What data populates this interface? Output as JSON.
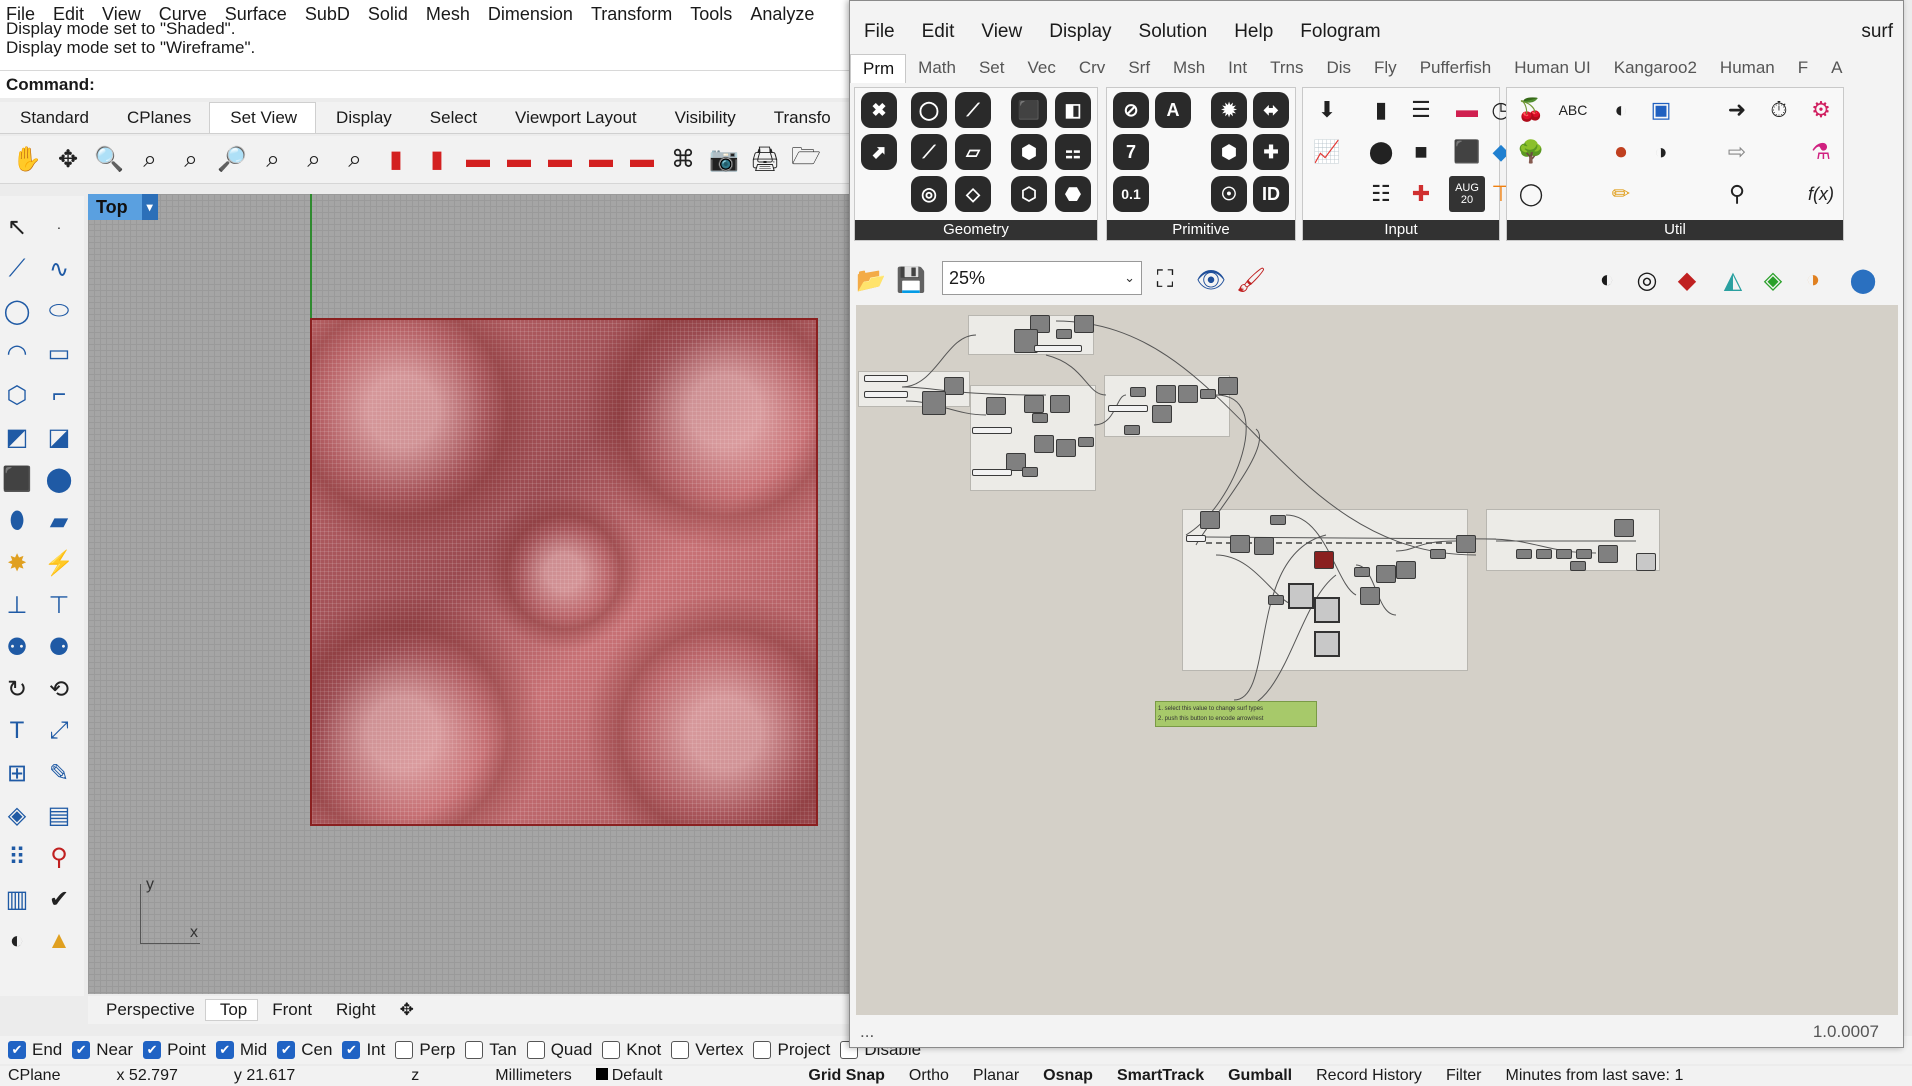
{
  "rhino": {
    "menu": [
      "File",
      "Edit",
      "View",
      "Curve",
      "Surface",
      "SubD",
      "Solid",
      "Mesh",
      "Dimension",
      "Transform",
      "Tools",
      "Analyze"
    ],
    "command_history": [
      "Display mode set to \"Shaded\".",
      "Display mode set to \"Wireframe\"."
    ],
    "command_prompt": "Command:",
    "toolbar_tabs": [
      "Standard",
      "CPlanes",
      "Set View",
      "Display",
      "Select",
      "Viewport Layout",
      "Visibility",
      "Transfo"
    ],
    "active_toolbar_tab": "Set View",
    "viewport": {
      "title": "Top",
      "caret": "▾",
      "axis_y": "y",
      "axis_x": "x"
    },
    "viewport_tabs": [
      "Perspective",
      "Top",
      "Front",
      "Right"
    ],
    "viewport_tab_add": "✥",
    "osnaps": [
      {
        "label": "End",
        "checked": true
      },
      {
        "label": "Near",
        "checked": true
      },
      {
        "label": "Point",
        "checked": true
      },
      {
        "label": "Mid",
        "checked": true
      },
      {
        "label": "Cen",
        "checked": true
      },
      {
        "label": "Int",
        "checked": true
      },
      {
        "label": "Perp",
        "checked": false
      },
      {
        "label": "Tan",
        "checked": false
      },
      {
        "label": "Quad",
        "checked": false
      },
      {
        "label": "Knot",
        "checked": false
      },
      {
        "label": "Vertex",
        "checked": false
      },
      {
        "label": "Project",
        "checked": false
      },
      {
        "label": "Disable",
        "checked": false
      }
    ],
    "status": {
      "cplane": "CPlane",
      "x": "x 52.797",
      "y": "y 21.617",
      "z": "z",
      "units": "Millimeters",
      "layer": "Default",
      "grid_snap": "Grid Snap",
      "ortho": "Ortho",
      "planar": "Planar",
      "osnap": "Osnap",
      "smarttrack": "SmartTrack",
      "gumball": "Gumball",
      "record_history": "Record History",
      "filter": "Filter",
      "save_info": "Minutes from last save: 1"
    }
  },
  "grasshopper": {
    "menu": [
      "File",
      "Edit",
      "View",
      "Display",
      "Solution",
      "Help",
      "Fologram"
    ],
    "doc_title": "surf",
    "tabs": [
      "Prm",
      "Math",
      "Set",
      "Vec",
      "Crv",
      "Srf",
      "Msh",
      "Int",
      "Trns",
      "Dis",
      "Fly",
      "Pufferfish",
      "Human UI",
      "Kangaroo2",
      "Human",
      "F",
      "A"
    ],
    "active_tab": "Prm",
    "panels": [
      "Geometry",
      "Primitive",
      "Input",
      "Util"
    ],
    "primitive_icons": [
      "A",
      "7",
      "0.1",
      "ID"
    ],
    "input_calendar": "AUG\n20",
    "zoom": "25%",
    "zoom_caret": "⌄",
    "note_text": [
      "1. select this value to change surf types",
      "2. push this button to encode arrow/rest"
    ],
    "footer_dots": "...",
    "version": "1.0.0007"
  }
}
